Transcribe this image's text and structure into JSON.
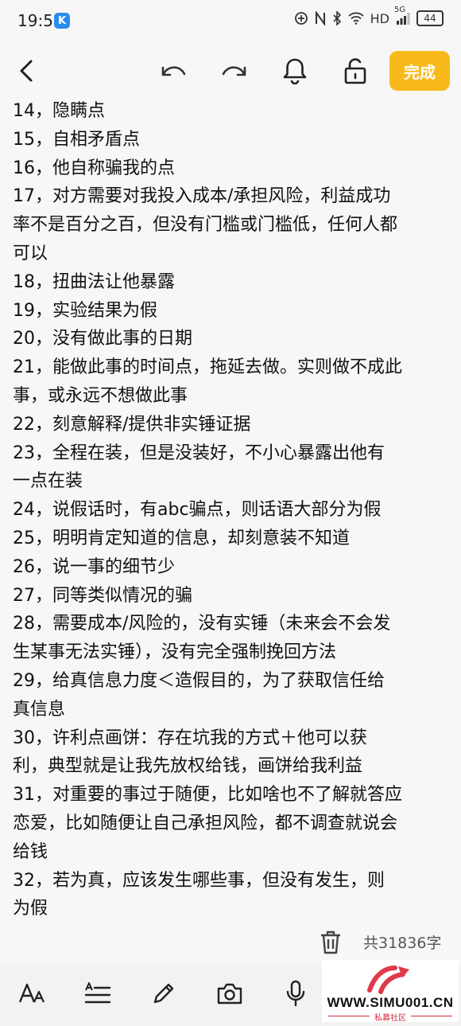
{
  "status_bar": {
    "time": "19:56",
    "app_badge": "K",
    "hd_label": "HD",
    "network_label": "5G",
    "battery_level": "44"
  },
  "toolbar": {
    "done_label": "完成",
    "accent_color": "#f8b91b"
  },
  "note": {
    "lines": [
      "14，隐瞒点",
      "15，自相矛盾点",
      "16，他自称骗我的点",
      "17，对方需要对我投入成本/承担风险，利益成功",
      "率不是百分之百，但没有门槛或门槛低，任何人都",
      "可以",
      "18，扭曲法让他暴露",
      "19，实验结果为假",
      "20，没有做此事的日期",
      "21，能做此事的时间点，拖延去做。实则做不成此",
      "事，或永远不想做此事",
      "22，刻意解释/提供非实锤证据",
      "23，全程在装，但是没装好，不小心暴露出他有",
      "一点在装",
      "24，说假话时，有abc骗点，则话语大部分为假",
      "25，明明肯定知道的信息，却刻意装不知道",
      "26，说一事的细节少",
      "27，同等类似情况的骗",
      "28，需要成本/风险的，没有实锤（未来会不会发",
      "生某事无法实锤），没有完全强制挽回方法",
      "29，给真信息力度＜造假目的，为了获取信任给",
      "真信息",
      "30，许利点画饼：存在坑我的方式＋他可以获",
      "利，典型就是让我先放权给钱，画饼给我利益",
      "31，对重要的事过于随便，比如啥也不了解就答应",
      "恋爱，比如随便让自己承担风险，都不调查就说会",
      "给钱",
      "32，若为真，应该发生哪些事，但没有发生，则",
      "为假"
    ]
  },
  "footer": {
    "word_count": "共31836字"
  },
  "watermark": {
    "url": "WWW.SIMU001.CN",
    "subtitle": "私募社区"
  }
}
